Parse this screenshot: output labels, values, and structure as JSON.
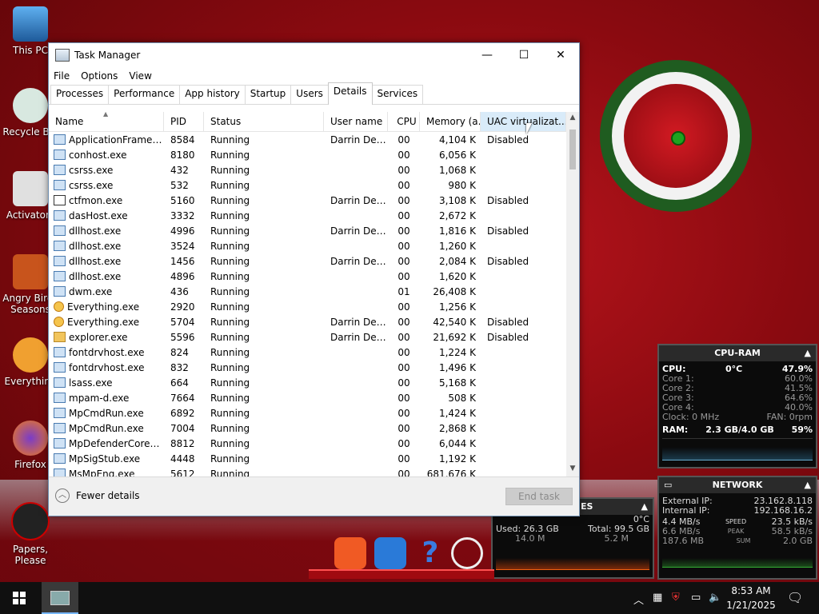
{
  "desktop": {
    "icons": [
      {
        "label": "This PC"
      },
      {
        "label": "Recycle Bin"
      },
      {
        "label": "Activators"
      },
      {
        "label": "Angry Birds Seasons"
      },
      {
        "label": "Everything"
      },
      {
        "label": "Firefox"
      },
      {
        "label": "Papers, Please"
      }
    ]
  },
  "window": {
    "title": "Task Manager",
    "menu": [
      "File",
      "Options",
      "View"
    ],
    "tabs": [
      "Processes",
      "Performance",
      "App history",
      "Startup",
      "Users",
      "Details",
      "Services"
    ],
    "active_tab": "Details",
    "columns": [
      "Name",
      "PID",
      "Status",
      "User name",
      "CPU",
      "Memory (a...",
      "UAC virtualizat..."
    ],
    "rows": [
      {
        "name": "ApplicationFrameHo...",
        "pid": "8584",
        "status": "Running",
        "user": "Darrin DeY...",
        "cpu": "00",
        "mem": "4,104 K",
        "uac": "Disabled"
      },
      {
        "name": "conhost.exe",
        "pid": "8180",
        "status": "Running",
        "user": "",
        "cpu": "00",
        "mem": "6,056 K",
        "uac": ""
      },
      {
        "name": "csrss.exe",
        "pid": "432",
        "status": "Running",
        "user": "",
        "cpu": "00",
        "mem": "1,068 K",
        "uac": ""
      },
      {
        "name": "csrss.exe",
        "pid": "532",
        "status": "Running",
        "user": "",
        "cpu": "00",
        "mem": "980 K",
        "uac": ""
      },
      {
        "name": "ctfmon.exe",
        "pid": "5160",
        "status": "Running",
        "user": "Darrin DeY...",
        "cpu": "00",
        "mem": "3,108 K",
        "uac": "Disabled"
      },
      {
        "name": "dasHost.exe",
        "pid": "3332",
        "status": "Running",
        "user": "",
        "cpu": "00",
        "mem": "2,672 K",
        "uac": ""
      },
      {
        "name": "dllhost.exe",
        "pid": "4996",
        "status": "Running",
        "user": "Darrin DeY...",
        "cpu": "00",
        "mem": "1,816 K",
        "uac": "Disabled"
      },
      {
        "name": "dllhost.exe",
        "pid": "3524",
        "status": "Running",
        "user": "",
        "cpu": "00",
        "mem": "1,260 K",
        "uac": ""
      },
      {
        "name": "dllhost.exe",
        "pid": "1456",
        "status": "Running",
        "user": "Darrin DeY...",
        "cpu": "00",
        "mem": "2,084 K",
        "uac": "Disabled"
      },
      {
        "name": "dllhost.exe",
        "pid": "4896",
        "status": "Running",
        "user": "",
        "cpu": "00",
        "mem": "1,620 K",
        "uac": ""
      },
      {
        "name": "dwm.exe",
        "pid": "436",
        "status": "Running",
        "user": "",
        "cpu": "01",
        "mem": "26,408 K",
        "uac": ""
      },
      {
        "name": "Everything.exe",
        "pid": "2920",
        "status": "Running",
        "user": "",
        "cpu": "00",
        "mem": "1,256 K",
        "uac": ""
      },
      {
        "name": "Everything.exe",
        "pid": "5704",
        "status": "Running",
        "user": "Darrin DeY...",
        "cpu": "00",
        "mem": "42,540 K",
        "uac": "Disabled"
      },
      {
        "name": "explorer.exe",
        "pid": "5596",
        "status": "Running",
        "user": "Darrin DeY...",
        "cpu": "00",
        "mem": "21,692 K",
        "uac": "Disabled"
      },
      {
        "name": "fontdrvhost.exe",
        "pid": "824",
        "status": "Running",
        "user": "",
        "cpu": "00",
        "mem": "1,224 K",
        "uac": ""
      },
      {
        "name": "fontdrvhost.exe",
        "pid": "832",
        "status": "Running",
        "user": "",
        "cpu": "00",
        "mem": "1,496 K",
        "uac": ""
      },
      {
        "name": "lsass.exe",
        "pid": "664",
        "status": "Running",
        "user": "",
        "cpu": "00",
        "mem": "5,168 K",
        "uac": ""
      },
      {
        "name": "mpam-d.exe",
        "pid": "7664",
        "status": "Running",
        "user": "",
        "cpu": "00",
        "mem": "508 K",
        "uac": ""
      },
      {
        "name": "MpCmdRun.exe",
        "pid": "6892",
        "status": "Running",
        "user": "",
        "cpu": "00",
        "mem": "1,424 K",
        "uac": ""
      },
      {
        "name": "MpCmdRun.exe",
        "pid": "7004",
        "status": "Running",
        "user": "",
        "cpu": "00",
        "mem": "2,868 K",
        "uac": ""
      },
      {
        "name": "MpDefenderCoreSer...",
        "pid": "8812",
        "status": "Running",
        "user": "",
        "cpu": "00",
        "mem": "6,044 K",
        "uac": ""
      },
      {
        "name": "MpSigStub.exe",
        "pid": "4448",
        "status": "Running",
        "user": "",
        "cpu": "00",
        "mem": "1,192 K",
        "uac": ""
      },
      {
        "name": "MsMpEng.exe",
        "pid": "5612",
        "status": "Running",
        "user": "",
        "cpu": "00",
        "mem": "681,676 K",
        "uac": ""
      }
    ],
    "fewer_details": "Fewer details",
    "end_task": "End task"
  },
  "cpu_ram": {
    "title": "CPU-RAM",
    "cpu_label": "CPU:",
    "cpu_temp": "0°C",
    "cpu_pct": "47.9%",
    "cores": [
      {
        "label": "Core 1:",
        "value": "60.0%"
      },
      {
        "label": "Core 2:",
        "value": "41.5%"
      },
      {
        "label": "Core 3:",
        "value": "64.6%"
      },
      {
        "label": "Core 4:",
        "value": "40.0%"
      }
    ],
    "clock": "Clock: 0 MHz",
    "fan": "FAN: 0rpm",
    "ram_label": "RAM:",
    "ram_used": "2.3 GB/4.0 GB",
    "ram_pct": "59%"
  },
  "network": {
    "title": "NETWORK",
    "ext_label": "External IP:",
    "ext_ip": "23.162.8.118",
    "int_label": "Internal IP:",
    "int_ip": "192.168.16.2",
    "speed_down": "4.4 MB/s",
    "speed_label": "SPEED",
    "speed_up": "23.5 kB/s",
    "peak_down": "6.6 MB/s",
    "peak_label": "PEAK",
    "peak_up": "58.5 kB/s",
    "sum_down": "187.6 MB",
    "sum_label": "SUM",
    "sum_up": "2.0 GB"
  },
  "drives": {
    "title": "ES",
    "temp": "0°C",
    "used": "Used: 26.3 GB",
    "total": "Total: 99.5 GB",
    "sub_left": "14.0 M",
    "sub_right": "5.2 M"
  },
  "clock": {
    "time": "8:53 AM",
    "date": "1/21/2025"
  }
}
